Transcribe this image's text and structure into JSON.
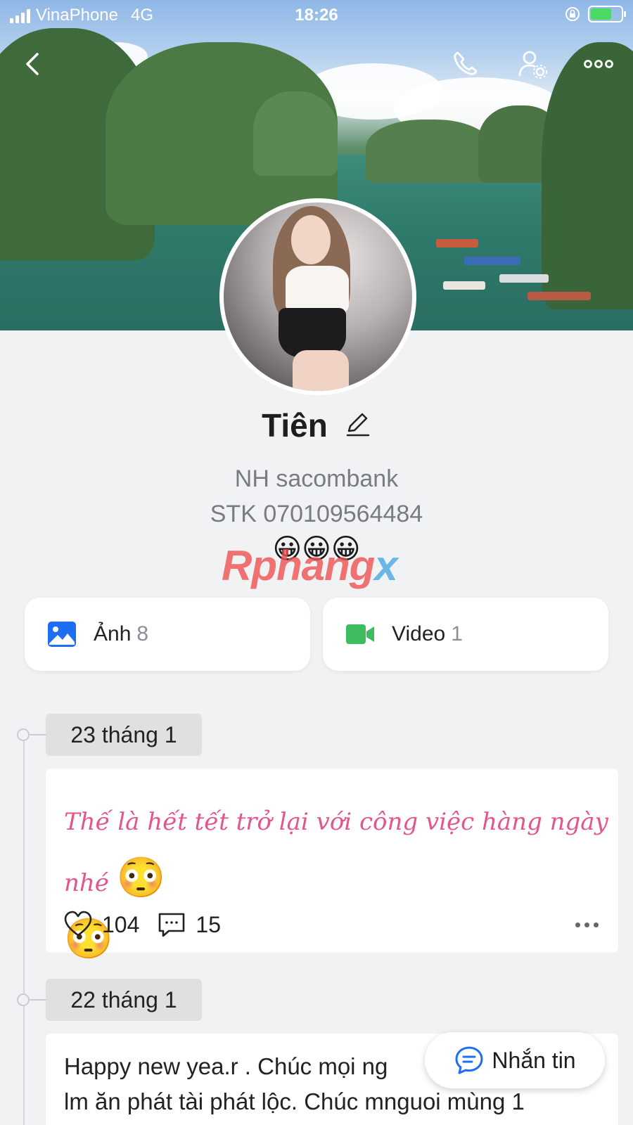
{
  "status_bar": {
    "carrier": "VinaPhone",
    "network": "4G",
    "time": "18:26"
  },
  "profile": {
    "name": "Tiên",
    "bio_line1": "NH sacombank",
    "bio_line2": "STK 070109564484",
    "bio_emojis": "😀😀😀"
  },
  "watermark": {
    "part1": "Rphang",
    "part2": "x"
  },
  "media": {
    "photos_label": "Ảnh",
    "photos_count": "8",
    "videos_label": "Video",
    "videos_count": "1"
  },
  "timeline": [
    {
      "date": "23 tháng 1",
      "text": "Thế là hết tết trở lại với công việc hàng ngày nhé",
      "emoji": "😳",
      "likes": "104",
      "comments": "15"
    },
    {
      "date": "22 tháng 1",
      "text_line1": "Happy new yea.r . Chúc mọi ng",
      "text_line2": "lm ăn phát tài phát lộc. Chúc mnguoi mùng 1"
    }
  ],
  "fab": {
    "label": "Nhắn tin"
  },
  "icons": {
    "back": "chevron-left-icon",
    "call": "phone-icon",
    "settings": "user-gear-icon",
    "more": "more-dots-icon",
    "edit": "pencil-icon",
    "photos": "image-icon",
    "videos": "video-camera-icon",
    "like": "heart-icon",
    "comment": "comment-icon",
    "message": "chat-bubble-icon"
  },
  "colors": {
    "background": "#f1f2f4",
    "accent_blue": "#1e6ef4",
    "video_green": "#3dbd5d",
    "post_pink": "#e4558c"
  }
}
